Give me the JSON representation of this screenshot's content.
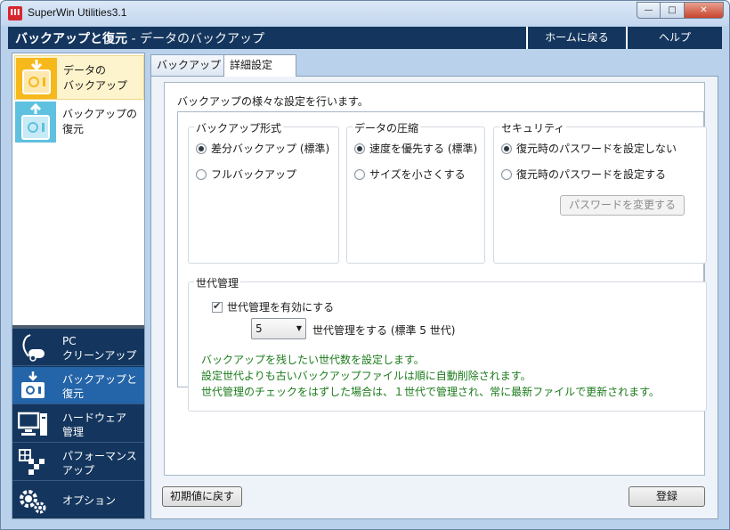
{
  "window": {
    "app_icon_text": "III",
    "title": "SuperWin Utilities3.1",
    "minimize": "—",
    "maximize": "□",
    "close": "✕"
  },
  "header": {
    "title_bold": "バックアップと復元",
    "title_sub": " - データのバックアップ",
    "home_link": "ホームに戻る",
    "help_link": "ヘルプ"
  },
  "sidebar": {
    "items": [
      {
        "label_1": "データの",
        "label_2": "バックアップ",
        "icon": "backup-safe-icon",
        "active": true
      },
      {
        "label_1": "バックアップの",
        "label_2": "復元",
        "icon": "restore-safe-icon",
        "active": false
      }
    ]
  },
  "bottom_nav": {
    "items": [
      {
        "label_1": "PC",
        "label_2": "クリーンアップ",
        "icon": "vacuum-cleaner-icon"
      },
      {
        "label_1": "バックアップと",
        "label_2": "復元",
        "icon": "backup-safe-icon"
      },
      {
        "label_1": "ハードウェア",
        "label_2": "管理",
        "icon": "computer-icon"
      },
      {
        "label_1": "パフォーマンス",
        "label_2": "アップ",
        "icon": "performance-chart-icon"
      },
      {
        "label_1": "オプション",
        "label_2": "",
        "icon": "gear-icon"
      }
    ]
  },
  "tabs": {
    "backup": "バックアップ",
    "advanced": "詳細設定"
  },
  "main": {
    "description": "バックアップの様々な設定を行います。",
    "backup_format": {
      "title": "バックアップ形式",
      "options": [
        "差分バックアップ (標準)",
        "フルバックアップ"
      ],
      "selected": 0
    },
    "compression": {
      "title": "データの圧縮",
      "options": [
        "速度を優先する (標準)",
        "サイズを小さくする"
      ],
      "selected": 0
    },
    "security": {
      "title": "セキュリティ",
      "options": [
        "復元時のパスワードを設定しない",
        "復元時のパスワードを設定する"
      ],
      "selected": 0,
      "change_password_button": "パスワードを変更する"
    },
    "generation": {
      "title": "世代管理",
      "enable_label": "世代管理を有効にする",
      "enabled": true,
      "count_value": "5",
      "count_suffix": "世代管理をする (標準 5 世代)",
      "info_lines": [
        "バックアップを残したい世代数を設定します。",
        "設定世代よりも古いバックアップファイルは順に自動削除されます。",
        "世代管理のチェックをはずした場合は、１世代で管理され、常に最新ファイルで更新されます。"
      ]
    },
    "reset_button": "初期値に戻す",
    "save_button": "登録"
  },
  "colors": {
    "header_bg": "#14365e",
    "nav_active": "#2464a8",
    "sidebar_active": "#fdf3cc",
    "info_text": "#1c7b1c"
  }
}
